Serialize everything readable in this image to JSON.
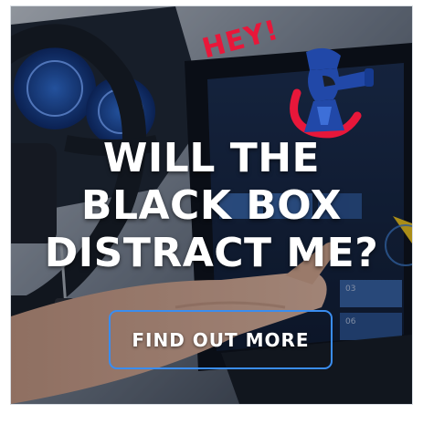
{
  "ad": {
    "exclaim": "HEY!",
    "headline": [
      "WILL THE",
      "BLACK BOX",
      "DISTRACT ME?"
    ],
    "cta_label": "FIND OUT MORE",
    "screen_tiles": [
      "03",
      "06"
    ]
  },
  "colors": {
    "accent_red": "#e8173a",
    "cta_border": "#3a8df0",
    "logo_blue": "#2148a8",
    "text": "#ffffff"
  },
  "icons": [
    "steering-wheel",
    "dashboard-gauge",
    "hand",
    "mascot-logo"
  ]
}
